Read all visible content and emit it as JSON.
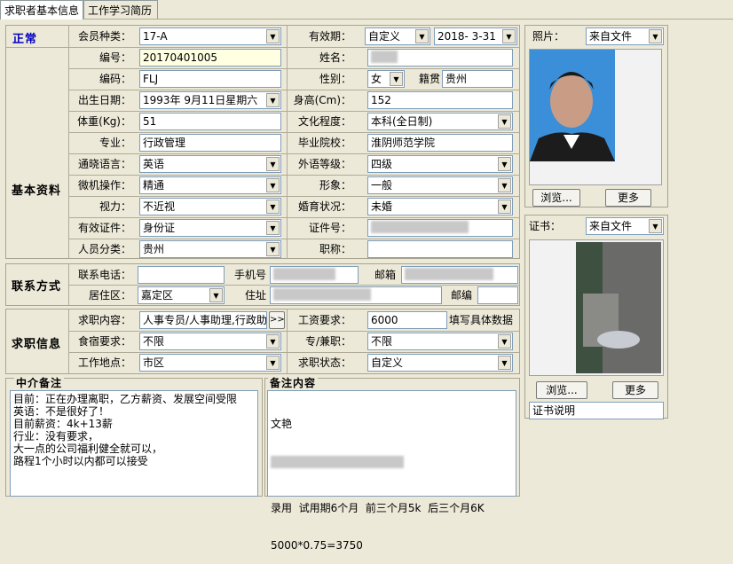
{
  "tabs": [
    "求职者基本信息",
    "工作学习简历"
  ],
  "status": "正常",
  "sections": {
    "basic": "基本资料",
    "contact": "联系方式",
    "job": "求职信息"
  },
  "labels": {
    "member_type": "会员种类：",
    "valid": "有效期：",
    "number": "编号：",
    "name": "姓名：",
    "code": "编码：",
    "gender": "性别：",
    "native": "籍贯",
    "birth": "出生日期：",
    "height": "身高(Cm)：",
    "weight": "体重(Kg)：",
    "education": "文化程度：",
    "major": "专业：",
    "school": "毕业院校：",
    "language": "通晓语言：",
    "foreign": "外语等级：",
    "computer": "微机操作：",
    "image": "形象：",
    "eyesight": "视力：",
    "marriage": "婚育状况：",
    "id_doc": "有效证件：",
    "id_no": "证件号：",
    "category": "人员分类：",
    "title": "职称：",
    "phone": "联系电话：",
    "mobile": "手机号",
    "email": "邮箱",
    "district": "居住区：",
    "address": "住址",
    "zip": "邮编",
    "job_content": "求职内容：",
    "salary": "工资要求：",
    "salary_note": "填写具体数据",
    "board": "食宿要求：",
    "fulltime": "专/兼职：",
    "location": "工作地点：",
    "job_status": "求职状态：",
    "photo": "照片：",
    "cert": "证书："
  },
  "values": {
    "member_type": "17-A",
    "valid_type": "自定义",
    "valid_date": "2018- 3-31",
    "number": "20170401005",
    "name": "",
    "code": "FLJ",
    "gender": "女",
    "native": "贵州",
    "birth": "1993年 9月11日星期六",
    "height": "152",
    "weight": "51",
    "education": "本科(全日制)",
    "major": "行政管理",
    "school": "淮阴师范学院",
    "language": "英语",
    "foreign": "四级",
    "computer": "精通",
    "image": "一般",
    "eyesight": "不近视",
    "marriage": "未婚",
    "id_doc": "身份证",
    "id_no": "",
    "category": "贵州",
    "title": "",
    "phone": "",
    "mobile": "",
    "email": "",
    "district": "嘉定区",
    "address": "",
    "zip": "",
    "job_content": "人事专员/人事助理,行政助",
    "salary": "6000",
    "board": "不限",
    "fulltime": "不限",
    "location": "市区",
    "job_status": "自定义",
    "photo_src": "来自文件",
    "cert_src": "来自文件",
    "cert_note": "证书说明"
  },
  "buttons": {
    "more_arrow": ">>",
    "browse": "浏览...",
    "more": "更多"
  },
  "memo": {
    "agent_title": "中介备注",
    "agent_text": "目前：正在办理离职，乙方薪资、发展空间受限\n英语：不是很好了！\n目前薪资：4k+13薪\n行业：没有要求，\n大一点的公司福利健全就可以，\n路程1个小时以内都可以接受",
    "note_title": "备注内容",
    "note_line1": "文艳",
    "note_line2": "",
    "note_line3": "录用  试用期6个月  前三个月5k  后三个月6K",
    "note_line4": "5000*0.75=3750"
  }
}
